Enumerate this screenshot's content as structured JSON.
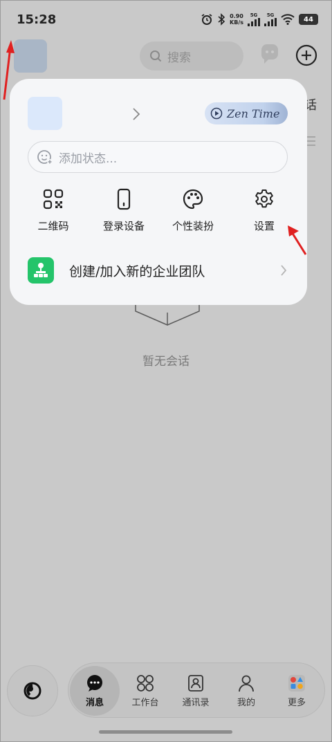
{
  "status_bar": {
    "time": "15:28",
    "net_speed_value": "0.90",
    "net_speed_unit": "KB/s",
    "signal_1_label": "5G",
    "signal_2_label": "5G",
    "battery": "44"
  },
  "header": {
    "search_placeholder": "搜索",
    "peek_text": "话"
  },
  "popup": {
    "zen_label": "Zen Time",
    "status_placeholder": "添加状态...",
    "quick_actions": [
      {
        "label": "二维码",
        "icon": "qr-code-icon"
      },
      {
        "label": "登录设备",
        "icon": "phone-device-icon"
      },
      {
        "label": "个性装扮",
        "icon": "palette-icon"
      },
      {
        "label": "设置",
        "icon": "gear-icon"
      }
    ],
    "team_label": "创建/加入新的企业团队"
  },
  "empty_state": {
    "text": "暂无会话"
  },
  "tabs": [
    {
      "label": "消息",
      "icon": "message-icon",
      "active": true
    },
    {
      "label": "工作台",
      "icon": "workbench-icon",
      "active": false
    },
    {
      "label": "通讯录",
      "icon": "contacts-icon",
      "active": false
    },
    {
      "label": "我的",
      "icon": "profile-icon",
      "active": false
    },
    {
      "label": "更多",
      "icon": "more-apps-icon",
      "active": false
    }
  ],
  "colors": {
    "backdrop": "#c9c9c9",
    "popup_bg": "#f5f6f8",
    "team_icon": "#24c46a",
    "annotation_arrow": "#e02020"
  }
}
